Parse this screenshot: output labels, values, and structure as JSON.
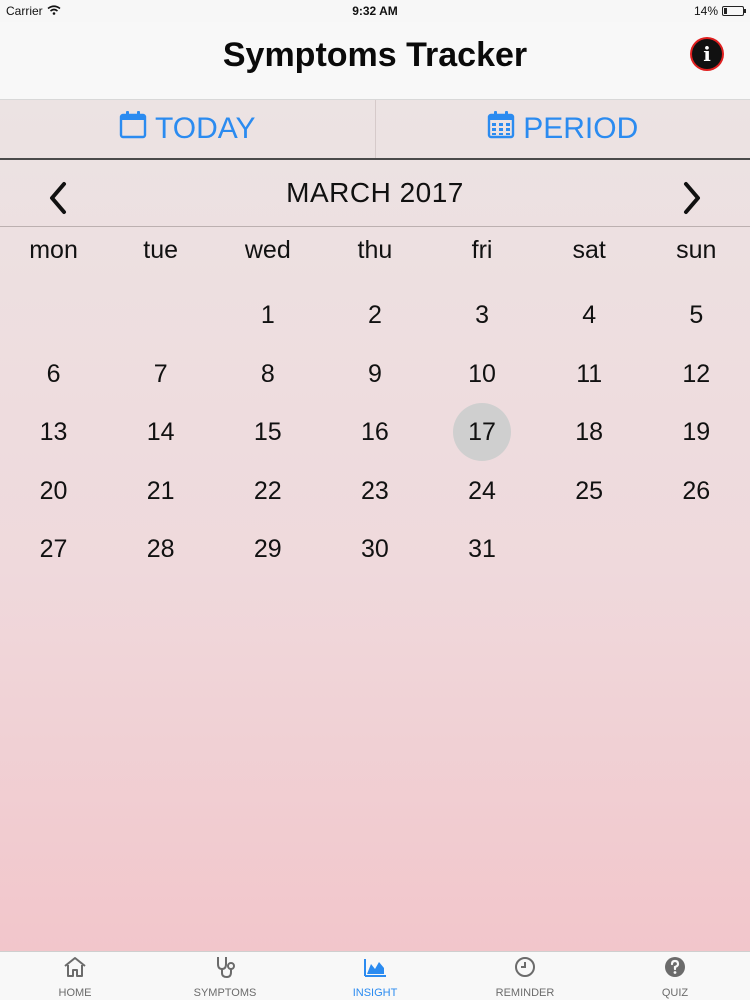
{
  "status": {
    "carrier": "Carrier",
    "time": "9:32 AM",
    "battery": "14%",
    "battery_level": 0.14
  },
  "nav": {
    "title": "Symptoms Tracker",
    "info_icon": "info-icon"
  },
  "segments": {
    "today": "TODAY",
    "period": "PERIOD"
  },
  "calendar": {
    "month": "MARCH 2017",
    "weekdays": [
      "mon",
      "tue",
      "wed",
      "thu",
      "fri",
      "sat",
      "sun"
    ],
    "weeks": [
      [
        "",
        "",
        "1",
        "2",
        "3",
        "4",
        "5"
      ],
      [
        "6",
        "7",
        "8",
        "9",
        "10",
        "11",
        "12"
      ],
      [
        "13",
        "14",
        "15",
        "16",
        "17",
        "18",
        "19"
      ],
      [
        "20",
        "21",
        "22",
        "23",
        "24",
        "25",
        "26"
      ],
      [
        "27",
        "28",
        "29",
        "30",
        "31",
        "",
        ""
      ]
    ],
    "selected_day": "17"
  },
  "tabs": [
    {
      "label": "HOME",
      "icon": "home-icon"
    },
    {
      "label": "SYMPTOMS",
      "icon": "stethoscope-icon"
    },
    {
      "label": "INSIGHT",
      "icon": "area-chart-icon"
    },
    {
      "label": "REMINDER",
      "icon": "clock-icon"
    },
    {
      "label": "QUIZ",
      "icon": "question-icon"
    }
  ],
  "active_tab": "INSIGHT",
  "colors": {
    "accent": "#2b8bf0",
    "selected_day_bg": "#cfcfcf",
    "background_top": "#ece3e3",
    "background_bottom": "#f2c6cb"
  }
}
